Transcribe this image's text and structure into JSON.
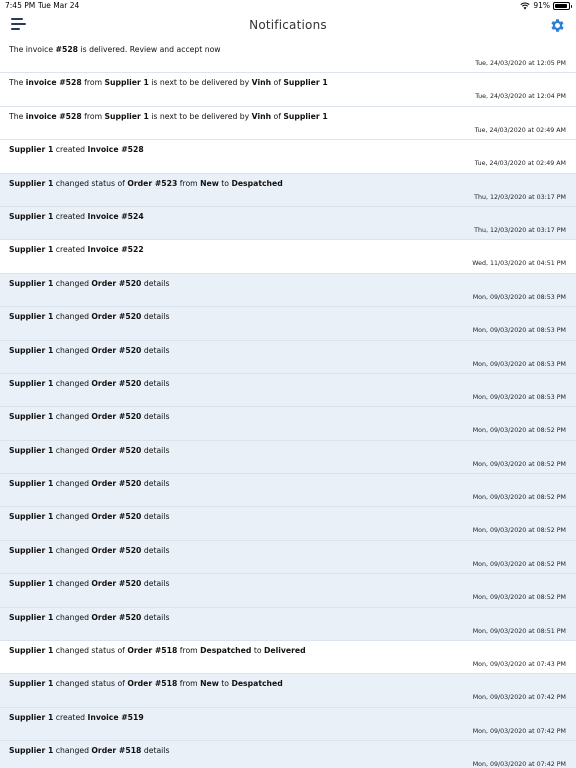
{
  "status_bar": {
    "time": "7:45 PM",
    "date": "Tue Mar 24",
    "battery": "91%",
    "battery_level": 0.91
  },
  "nav": {
    "title": "Notifications"
  },
  "notifications": [
    {
      "unread": false,
      "parts": [
        {
          "t": "The invoice "
        },
        {
          "b": "#528"
        },
        {
          "t": " is delivered. Review and accept now"
        }
      ],
      "time": "Tue, 24/03/2020 at 12:05 PM"
    },
    {
      "unread": false,
      "parts": [
        {
          "t": "The "
        },
        {
          "b": "invoice #528"
        },
        {
          "t": " from "
        },
        {
          "b": "Supplier 1"
        },
        {
          "t": " is next to be delivered by "
        },
        {
          "b": "Vinh"
        },
        {
          "t": " of "
        },
        {
          "b": "Supplier 1"
        }
      ],
      "time": "Tue, 24/03/2020 at 12:04 PM"
    },
    {
      "unread": false,
      "parts": [
        {
          "t": "The "
        },
        {
          "b": "invoice #528"
        },
        {
          "t": " from "
        },
        {
          "b": "Supplier 1"
        },
        {
          "t": " is next to be delivered by "
        },
        {
          "b": "Vinh"
        },
        {
          "t": " of "
        },
        {
          "b": "Supplier 1"
        }
      ],
      "time": "Tue, 24/03/2020 at 02:49 AM"
    },
    {
      "unread": false,
      "parts": [
        {
          "b": "Supplier 1"
        },
        {
          "t": " created "
        },
        {
          "b": "Invoice #528"
        }
      ],
      "time": "Tue, 24/03/2020 at 02:49 AM"
    },
    {
      "unread": true,
      "parts": [
        {
          "b": "Supplier 1"
        },
        {
          "t": " changed status of "
        },
        {
          "b": "Order #523"
        },
        {
          "t": " from "
        },
        {
          "b": "New"
        },
        {
          "t": " to "
        },
        {
          "b": "Despatched"
        }
      ],
      "time": "Thu, 12/03/2020 at 03:17 PM"
    },
    {
      "unread": true,
      "parts": [
        {
          "b": "Supplier 1"
        },
        {
          "t": " created "
        },
        {
          "b": "Invoice #524"
        }
      ],
      "time": "Thu, 12/03/2020 at 03:17 PM"
    },
    {
      "unread": false,
      "parts": [
        {
          "b": "Supplier 1"
        },
        {
          "t": " created "
        },
        {
          "b": "Invoice #522"
        }
      ],
      "time": "Wed, 11/03/2020 at 04:51 PM"
    },
    {
      "unread": true,
      "parts": [
        {
          "b": "Supplier 1"
        },
        {
          "t": " changed "
        },
        {
          "b": "Order #520"
        },
        {
          "t": " details"
        }
      ],
      "time": "Mon, 09/03/2020 at 08:53 PM"
    },
    {
      "unread": true,
      "parts": [
        {
          "b": "Supplier 1"
        },
        {
          "t": " changed "
        },
        {
          "b": "Order #520"
        },
        {
          "t": " details"
        }
      ],
      "time": "Mon, 09/03/2020 at 08:53 PM"
    },
    {
      "unread": true,
      "parts": [
        {
          "b": "Supplier 1"
        },
        {
          "t": " changed "
        },
        {
          "b": "Order #520"
        },
        {
          "t": " details"
        }
      ],
      "time": "Mon, 09/03/2020 at 08:53 PM"
    },
    {
      "unread": true,
      "parts": [
        {
          "b": "Supplier 1"
        },
        {
          "t": " changed "
        },
        {
          "b": "Order #520"
        },
        {
          "t": " details"
        }
      ],
      "time": "Mon, 09/03/2020 at 08:53 PM"
    },
    {
      "unread": true,
      "parts": [
        {
          "b": "Supplier 1"
        },
        {
          "t": " changed "
        },
        {
          "b": "Order #520"
        },
        {
          "t": " details"
        }
      ],
      "time": "Mon, 09/03/2020 at 08:52 PM"
    },
    {
      "unread": true,
      "parts": [
        {
          "b": "Supplier 1"
        },
        {
          "t": " changed "
        },
        {
          "b": "Order #520"
        },
        {
          "t": " details"
        }
      ],
      "time": "Mon, 09/03/2020 at 08:52 PM"
    },
    {
      "unread": true,
      "parts": [
        {
          "b": "Supplier 1"
        },
        {
          "t": " changed "
        },
        {
          "b": "Order #520"
        },
        {
          "t": " details"
        }
      ],
      "time": "Mon, 09/03/2020 at 08:52 PM"
    },
    {
      "unread": true,
      "parts": [
        {
          "b": "Supplier 1"
        },
        {
          "t": " changed "
        },
        {
          "b": "Order #520"
        },
        {
          "t": " details"
        }
      ],
      "time": "Mon, 09/03/2020 at 08:52 PM"
    },
    {
      "unread": true,
      "parts": [
        {
          "b": "Supplier 1"
        },
        {
          "t": " changed "
        },
        {
          "b": "Order #520"
        },
        {
          "t": " details"
        }
      ],
      "time": "Mon, 09/03/2020 at 08:52 PM"
    },
    {
      "unread": true,
      "parts": [
        {
          "b": "Supplier 1"
        },
        {
          "t": " changed "
        },
        {
          "b": "Order #520"
        },
        {
          "t": " details"
        }
      ],
      "time": "Mon, 09/03/2020 at 08:52 PM"
    },
    {
      "unread": true,
      "parts": [
        {
          "b": "Supplier 1"
        },
        {
          "t": " changed "
        },
        {
          "b": "Order #520"
        },
        {
          "t": " details"
        }
      ],
      "time": "Mon, 09/03/2020 at 08:51 PM"
    },
    {
      "unread": false,
      "parts": [
        {
          "b": "Supplier 1"
        },
        {
          "t": " changed status of "
        },
        {
          "b": "Order #518"
        },
        {
          "t": " from "
        },
        {
          "b": "Despatched"
        },
        {
          "t": " to "
        },
        {
          "b": "Delivered"
        }
      ],
      "time": "Mon, 09/03/2020 at 07:43 PM"
    },
    {
      "unread": true,
      "parts": [
        {
          "b": "Supplier 1"
        },
        {
          "t": " changed status of "
        },
        {
          "b": "Order #518"
        },
        {
          "t": " from "
        },
        {
          "b": "New"
        },
        {
          "t": " to "
        },
        {
          "b": "Despatched"
        }
      ],
      "time": "Mon, 09/03/2020 at 07:42 PM"
    },
    {
      "unread": true,
      "parts": [
        {
          "b": "Supplier 1"
        },
        {
          "t": " created "
        },
        {
          "b": "Invoice #519"
        }
      ],
      "time": "Mon, 09/03/2020 at 07:42 PM"
    },
    {
      "unread": true,
      "parts": [
        {
          "b": "Supplier 1"
        },
        {
          "t": " changed "
        },
        {
          "b": "Order #518"
        },
        {
          "t": " details"
        }
      ],
      "time": "Mon, 09/03/2020 at 07:42 PM"
    }
  ],
  "colors": {
    "unread_bg": "#eaf0f8",
    "read_bg": "#ffffff",
    "accent": "#2f7fd8",
    "icon_dark": "#2b3a55"
  }
}
